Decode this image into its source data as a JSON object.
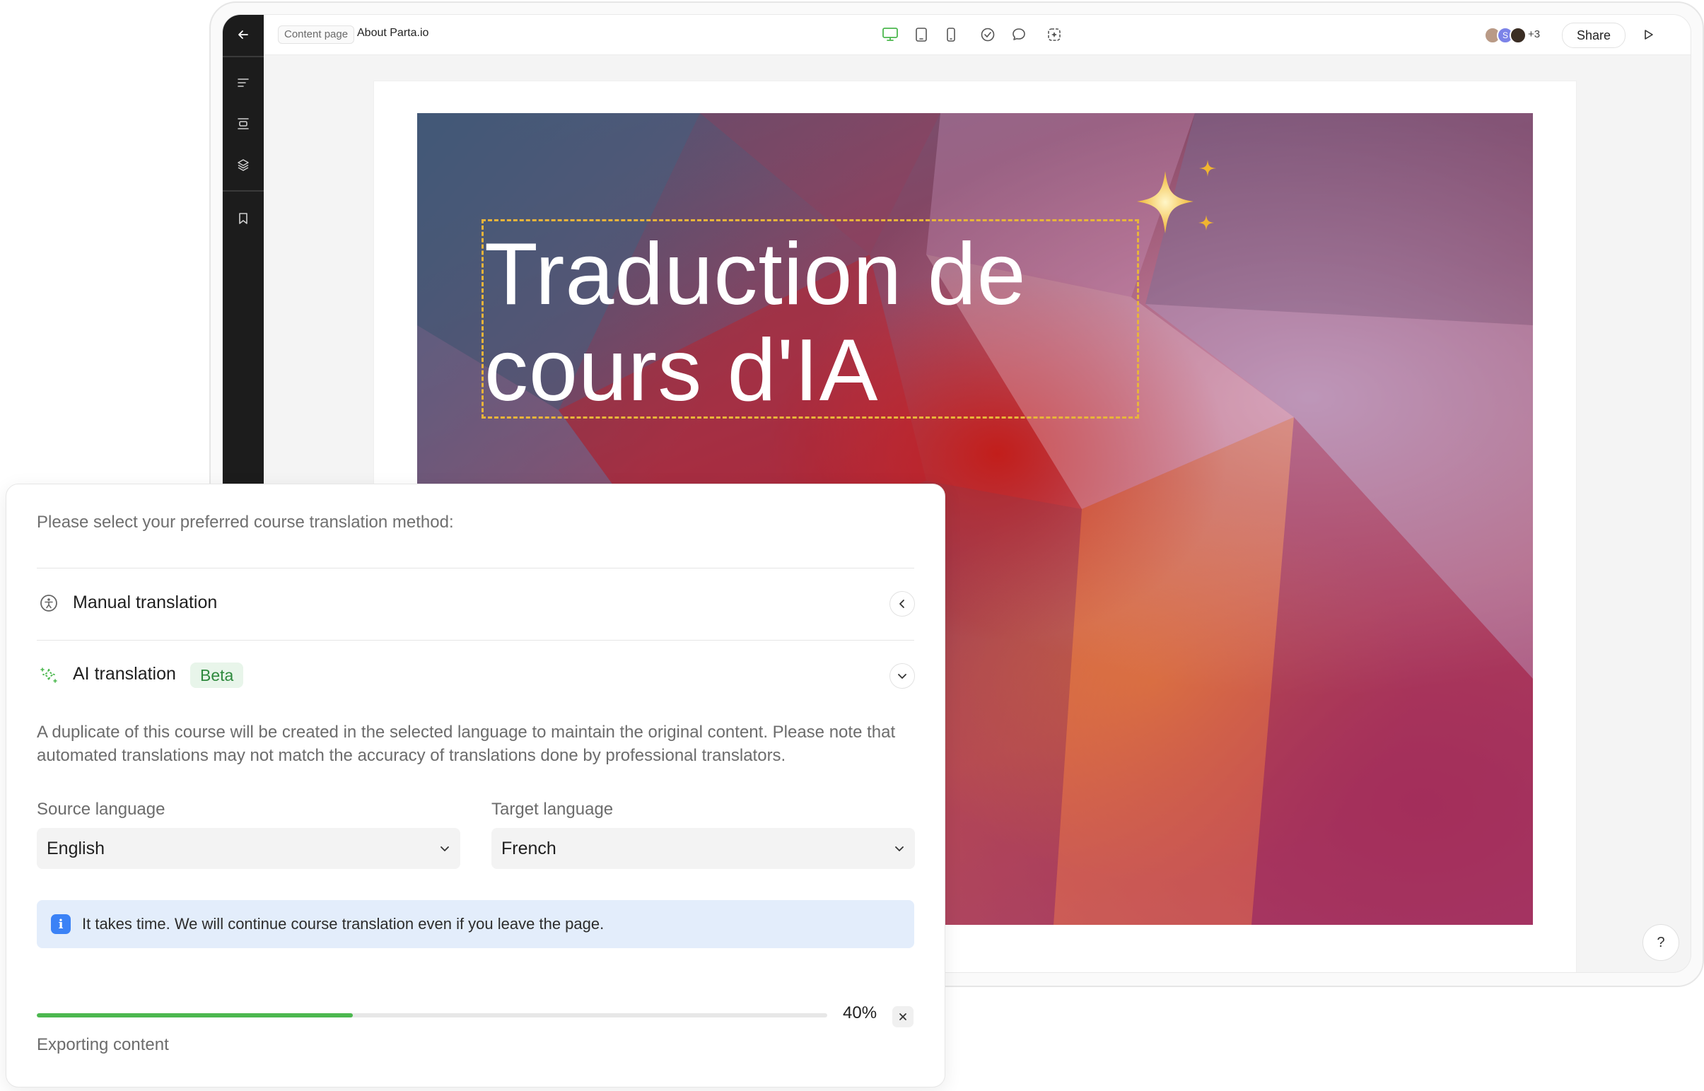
{
  "editor": {
    "breadcrumb_tag": "Content page",
    "page_title": "About Parta.io",
    "collaborators": [
      {
        "initial": "",
        "color": "#b99a86"
      },
      {
        "initial": "S",
        "color": "#7c83e8"
      },
      {
        "initial": "",
        "color": "#3a2d24"
      }
    ],
    "collaborators_more": "+3",
    "share_label": "Share",
    "help_label": "?"
  },
  "hero": {
    "title": "Traduction de cours d'IA"
  },
  "translation": {
    "prompt": "Please select your preferred course translation method:",
    "manual_label": "Manual translation",
    "ai_label": "AI translation",
    "ai_badge": "Beta",
    "description": "A duplicate of this course will be created in the selected language to maintain the original content. Please note that automated translations may not match the accuracy of translations done by professional translators.",
    "source_label": "Source language",
    "source_value": "English",
    "target_label": "Target language",
    "target_value": "French",
    "notice": "It takes time. We will continue course translation even if you leave the page.",
    "progress_fraction": 0.4,
    "progress_text": "40%",
    "status": "Exporting content"
  },
  "colors": {
    "accent_green": "#4cb84f",
    "badge_green": "#2f8a3e",
    "info_blue": "#3b82f6",
    "rail_dark": "#1c1c1c"
  }
}
